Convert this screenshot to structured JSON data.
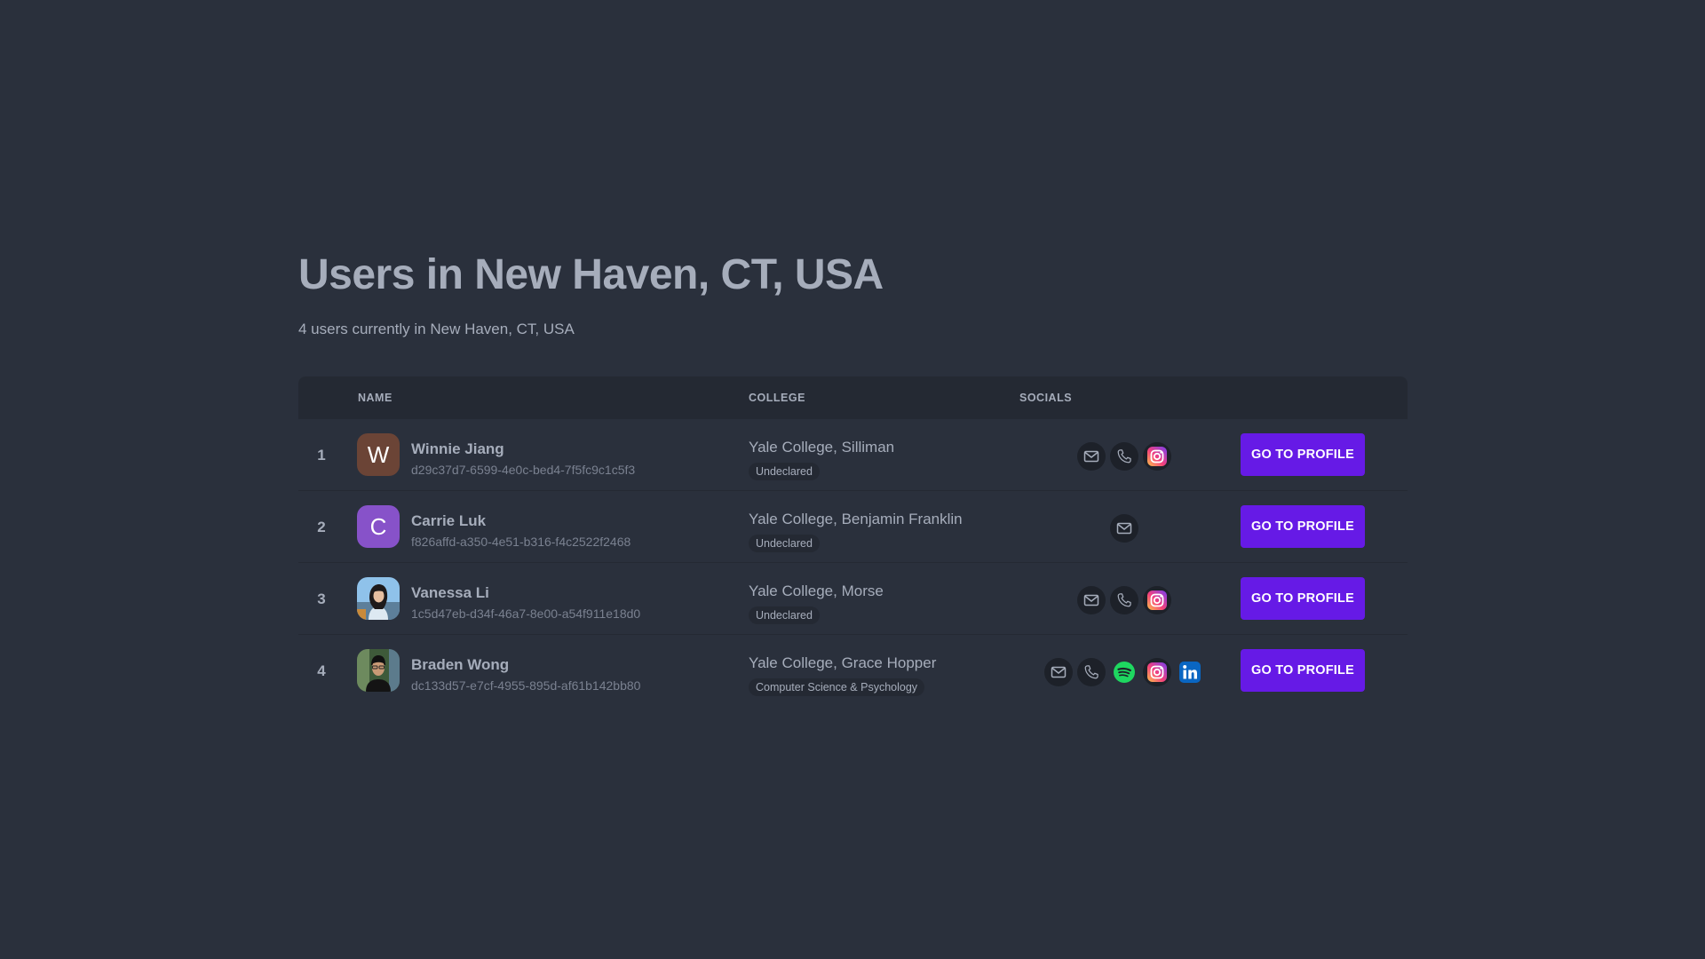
{
  "page": {
    "title": "Users in New Haven, CT, USA",
    "subtitle": "4 users currently in New Haven, CT, USA"
  },
  "table": {
    "headers": {
      "name": "NAME",
      "college": "COLLEGE",
      "socials": "SOCIALS"
    },
    "rows": [
      {
        "index": "1",
        "avatar": {
          "type": "letter",
          "letter": "W",
          "color": "#6b4436"
        },
        "name": "Winnie Jiang",
        "id": "d29c37d7-6599-4e0c-bed4-7f5fc9c1c5f3",
        "college": "Yale College, Silliman",
        "major": "Undeclared",
        "socials": [
          "email-icon",
          "phone-icon",
          "instagram-icon"
        ],
        "button": "GO TO PROFILE"
      },
      {
        "index": "2",
        "avatar": {
          "type": "letter",
          "letter": "C",
          "color": "#8752c9"
        },
        "name": "Carrie Luk",
        "id": "f826affd-a350-4e51-b316-f4c2522f2468",
        "college": "Yale College, Benjamin Franklin",
        "major": "Undeclared",
        "socials": [
          "email-icon"
        ],
        "button": "GO TO PROFILE"
      },
      {
        "index": "3",
        "avatar": {
          "type": "photo",
          "variant": "light"
        },
        "name": "Vanessa Li",
        "id": "1c5d47eb-d34f-46a7-8e00-a54f911e18d0",
        "college": "Yale College, Morse",
        "major": "Undeclared",
        "socials": [
          "email-icon",
          "phone-icon",
          "instagram-icon"
        ],
        "button": "GO TO PROFILE"
      },
      {
        "index": "4",
        "avatar": {
          "type": "photo",
          "variant": "dark"
        },
        "name": "Braden Wong",
        "id": "dc133d57-e7cf-4955-895d-af61b142bb80",
        "college": "Yale College, Grace Hopper",
        "major": "Computer Science & Psychology",
        "socials": [
          "email-icon",
          "phone-icon",
          "spotify-icon",
          "instagram-icon",
          "linkedin-icon"
        ],
        "button": "GO TO PROFILE"
      }
    ]
  },
  "colors": {
    "background": "#2a303c",
    "header": "#242933",
    "text": "#a6adbb",
    "primary_button": "#661ae6"
  }
}
